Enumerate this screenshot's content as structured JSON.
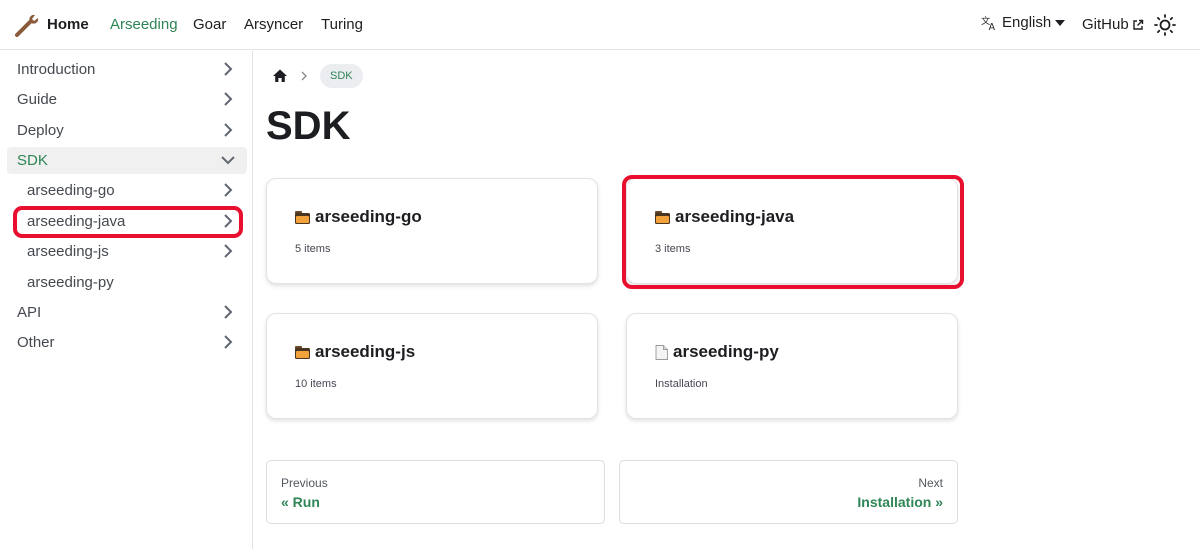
{
  "navbar": {
    "brand": "Home",
    "links": [
      "Arseeding",
      "Goar",
      "Arsyncer",
      "Turing"
    ],
    "language": "English",
    "github": "GitHub"
  },
  "sidebar": {
    "items": [
      {
        "label": "Introduction"
      },
      {
        "label": "Guide"
      },
      {
        "label": "Deploy"
      },
      {
        "label": "SDK"
      },
      {
        "label": "arseeding-go"
      },
      {
        "label": "arseeding-java"
      },
      {
        "label": "arseeding-js"
      },
      {
        "label": "arseeding-py"
      },
      {
        "label": "API"
      },
      {
        "label": "Other"
      }
    ]
  },
  "breadcrumb": {
    "current": "SDK"
  },
  "page": {
    "title": "SDK"
  },
  "cards": [
    {
      "title": "arseeding-go",
      "subtitle": "5 items",
      "icon": "folder-icon"
    },
    {
      "title": "arseeding-java",
      "subtitle": "3 items",
      "icon": "folder-icon"
    },
    {
      "title": "arseeding-js",
      "subtitle": "10 items",
      "icon": "folder-icon"
    },
    {
      "title": "arseeding-py",
      "subtitle": "Installation",
      "icon": "document-icon"
    }
  ],
  "pagination": {
    "previous_sub": "Previous",
    "previous_label": "« Run",
    "next_sub": "Next",
    "next_label": "Installation »"
  },
  "colors": {
    "accent": "#2e8555",
    "highlight": "#e8102e"
  }
}
